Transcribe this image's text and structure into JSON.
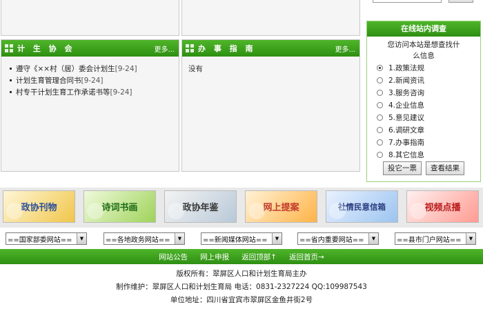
{
  "panels": {
    "jisheng": {
      "title": "计 生 协 会",
      "more": "更多...",
      "items": [
        {
          "text": "遵守《××村（居）委会计划生",
          "date": "[9-24]"
        },
        {
          "text": "计划生育管理合同书",
          "date": "[9-24]"
        },
        {
          "text": "村专干计划生育工作承诺书等",
          "date": "[9-24]"
        }
      ]
    },
    "banshi": {
      "title": "办 事 指 南",
      "more": "更多...",
      "empty_text": "没有"
    }
  },
  "survey": {
    "title": "在线站内调查",
    "question_line1": "您访问本站是想查找什",
    "question_line2": "么信息",
    "options": [
      "1.政策法规",
      "2.新闻资讯",
      "3.服务咨询",
      "4.企业信息",
      "5.意见建议",
      "6.调研文章",
      "7.办事指南",
      "8.其它信息"
    ],
    "selected_index": 0,
    "vote_label": "投它一票",
    "results_label": "查看结果"
  },
  "banners": [
    {
      "label": "政协刊物",
      "icon": "book-icon"
    },
    {
      "label": "诗词书画",
      "icon": "brush-icon"
    },
    {
      "label": "政协年鉴",
      "icon": "disc-icon"
    },
    {
      "label": "网上提案",
      "icon": "paper-icon"
    },
    {
      "label": "社情民意信箱",
      "icon": "mailbox-icon"
    },
    {
      "label": "视频点播",
      "icon": "camera-icon"
    }
  ],
  "selects": [
    "==国家部委网站==",
    "==各地政务网站==",
    "==新闻媒体网站==",
    "==省内重要网站==",
    "==县市门户网站=="
  ],
  "footer_nav": [
    "网站公告",
    "网上申报",
    "返回顶部↑",
    "返回首页→"
  ],
  "footer_info": {
    "copyright": "版权所有：翠屏区人口和计划生育局主办",
    "maintainer": "制作维护：翠屏区人口和计划生育局  电话：0831-2327224 QQ:109987543",
    "address": "单位地址：四川省宜宾市翠屏区金鱼井街2号"
  },
  "colors": {
    "green": "#3a9e1c",
    "panel_bg": "#f5f5f5"
  }
}
